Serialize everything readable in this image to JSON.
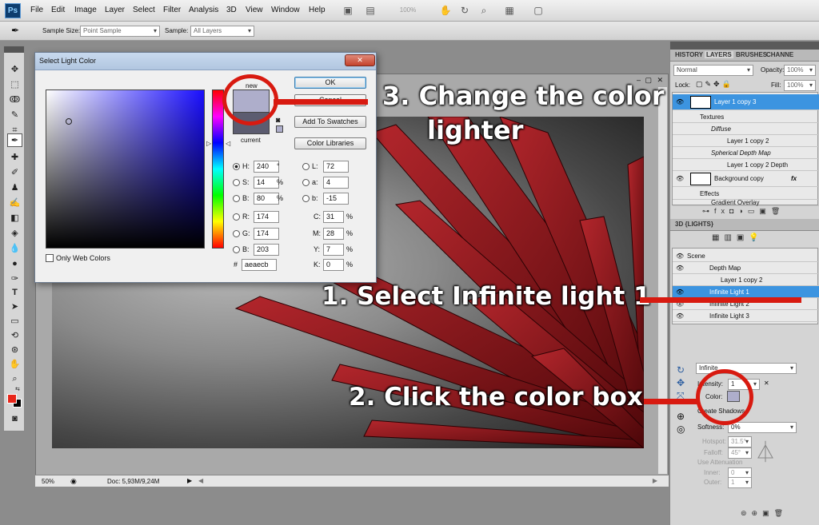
{
  "app": {
    "logo": "Ps"
  },
  "menu": [
    "File",
    "Edit",
    "Image",
    "Layer",
    "Select",
    "Filter",
    "Analysis",
    "3D",
    "View",
    "Window",
    "Help"
  ],
  "toolbar": {
    "zoom": "100%"
  },
  "options_bar": {
    "sample_size_label": "Sample Size:",
    "sample_size_value": "Point Sample",
    "sample_label": "Sample:",
    "sample_value": "All Layers"
  },
  "dialog": {
    "title": "Select Light Color",
    "close_glyph": "✕",
    "new_label": "new",
    "current_label": "current",
    "new_color": "#aeaecb",
    "current_color": "#5c5c70",
    "ok": "OK",
    "cancel": "Cancel",
    "add_to_swatches": "Add To Swatches",
    "color_libraries": "Color Libraries",
    "only_web_colors": "Only Web Colors",
    "fields": {
      "H": {
        "label": "H:",
        "value": "240",
        "unit": "°"
      },
      "S": {
        "label": "S:",
        "value": "14",
        "unit": "%"
      },
      "B": {
        "label": "B:",
        "value": "80",
        "unit": "%"
      },
      "R": {
        "label": "R:",
        "value": "174"
      },
      "G": {
        "label": "G:",
        "value": "174"
      },
      "Bl": {
        "label": "B:",
        "value": "203"
      },
      "L": {
        "label": "L:",
        "value": "72"
      },
      "a": {
        "label": "a:",
        "value": "4"
      },
      "b": {
        "label": "b:",
        "value": "-15"
      },
      "C": {
        "label": "C:",
        "value": "31",
        "unit": "%"
      },
      "M": {
        "label": "M:",
        "value": "28",
        "unit": "%"
      },
      "Y": {
        "label": "Y:",
        "value": "7",
        "unit": "%"
      },
      "K": {
        "label": "K:",
        "value": "0",
        "unit": "%"
      },
      "hex_label": "#",
      "hex": "aeaecb"
    }
  },
  "document": {
    "zoom": "50%",
    "doc_info": "Doc: 5,93M/9,24M"
  },
  "layers_panel": {
    "tabs": [
      "HISTORY",
      "LAYERS",
      "BRUSHES",
      "CHANNE"
    ],
    "blend_mode": "Normal",
    "opacity_label": "Opacity:",
    "opacity": "100%",
    "lock_label": "Lock:",
    "fill_label": "Fill:",
    "fill": "100%",
    "rows": [
      {
        "name": "Layer 1 copy 3"
      },
      {
        "name": "Textures"
      },
      {
        "name": "Diffuse"
      },
      {
        "name": "Layer 1 copy 2"
      },
      {
        "name": "Spherical Depth Map"
      },
      {
        "name": "Layer 1 copy 2 Depth"
      },
      {
        "name": "Background copy"
      },
      {
        "name": "Effects"
      },
      {
        "name": "Gradient Overlay"
      }
    ]
  },
  "lights_panel": {
    "title": "3D {LIGHTS}",
    "rows": [
      {
        "name": "Scene"
      },
      {
        "name": "Depth Map"
      },
      {
        "name": "Layer 1 copy 2"
      },
      {
        "name": "Infinite Light 1"
      },
      {
        "name": "Infinite Light 2"
      },
      {
        "name": "Infinite Light 3"
      }
    ],
    "light_type": "Infinite",
    "intensity_label": "Intensity:",
    "intensity": "1",
    "color_label": "Color:",
    "light_color": "#aeaecb",
    "create_shadows": "Create Shadows",
    "softness_label": "Softness:",
    "softness": "0%",
    "hotspot_label": "Hotspot:",
    "hotspot": "31.5°",
    "falloff_label": "Falloff:",
    "falloff": "45°",
    "use_attenuation": "Use Attenuation",
    "inner_label": "Inner:",
    "inner": "0",
    "outer_label": "Outer:",
    "outer": "1"
  },
  "annotations": {
    "step1": "1. Select Infinite light 1",
    "step2": "2. Click the color box",
    "step3_line1": "3. Change the color",
    "step3_line2": "lighter"
  },
  "colors": {
    "accent": "#3c94e0",
    "annotation_red": "#d81a10",
    "foreground": "#e8261a"
  }
}
